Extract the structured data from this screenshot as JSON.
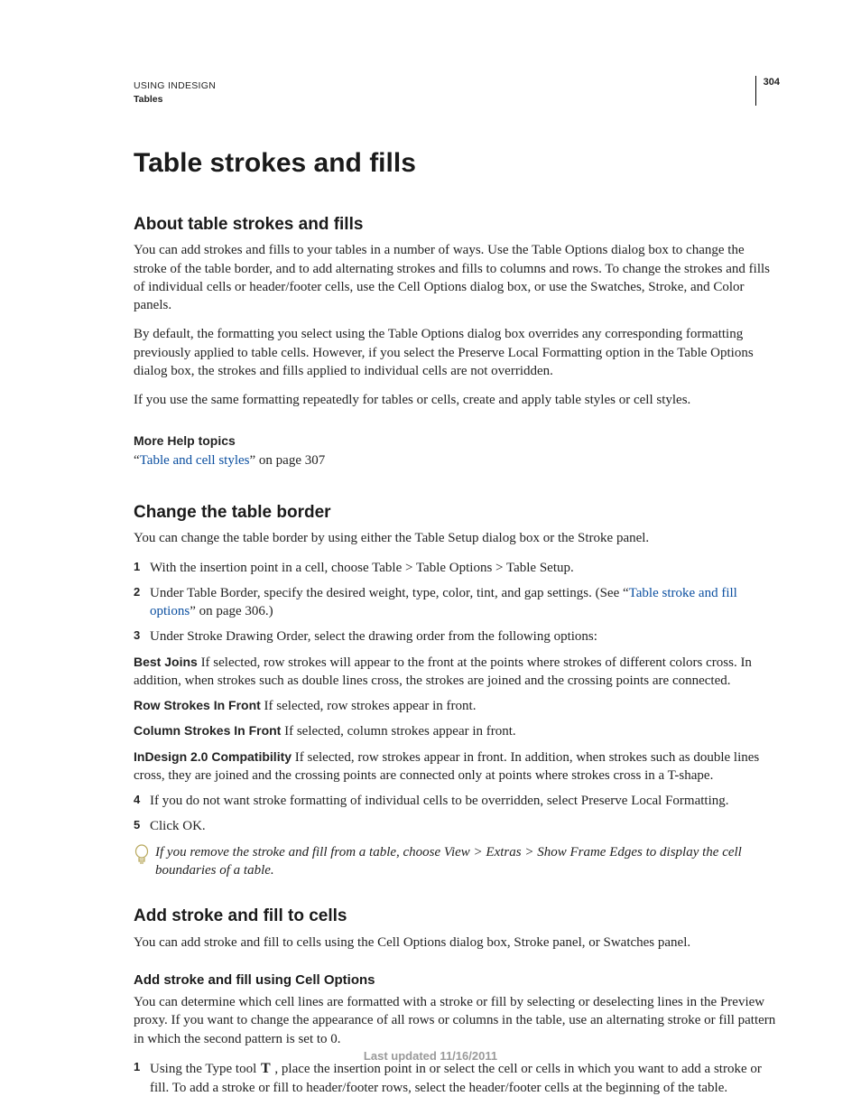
{
  "header": {
    "running_title": "USING INDESIGN",
    "section": "Tables",
    "page_number": "304"
  },
  "main_heading": "Table strokes and fills",
  "section1": {
    "heading": "About table strokes and fills",
    "p1": "You can add strokes and fills to your tables in a number of ways. Use the Table Options dialog box to change the stroke of the table border, and to add alternating strokes and fills to columns and rows. To change the strokes and fills of individual cells or header/footer cells, use the Cell Options dialog box, or use the Swatches, Stroke, and Color panels.",
    "p2": "By default, the formatting you select using the Table Options dialog box overrides any corresponding formatting previously applied to table cells. However, if you select the Preserve Local Formatting option in the Table Options dialog box, the strokes and fills applied to individual cells are not overridden.",
    "p3": "If you use the same formatting repeatedly for tables or cells, create and apply table styles or cell styles."
  },
  "more_help": {
    "heading": "More Help topics",
    "quote_open": "“",
    "link_text": "Table and cell styles",
    "rest": "” on page 307"
  },
  "section2": {
    "heading": "Change the table border",
    "intro": "You can change the table border by using either the Table Setup dialog box or the Stroke panel.",
    "step1": "With the insertion point in a cell, choose Table > Table Options > Table Setup.",
    "step2_a": "Under Table Border, specify the desired weight, type, color, tint, and gap settings. (See “",
    "step2_link": "Table stroke and fill options",
    "step2_b": "” on page 306.)",
    "step3": "Under Stroke Drawing Order, select the drawing order from the following options:",
    "defs": {
      "best_joins_term": "Best Joins",
      "best_joins_text": "  If selected, row strokes will appear to the front at the points where strokes of different colors cross. In addition, when strokes such as double lines cross, the strokes are joined and the crossing points are connected.",
      "row_front_term": "Row Strokes In Front",
      "row_front_text": "  If selected, row strokes appear in front.",
      "col_front_term": "Column Strokes In Front",
      "col_front_text": "  If selected, column strokes appear in front.",
      "compat_term": "InDesign 2.0 Compatibility",
      "compat_text": "  If selected, row strokes appear in front. In addition, when strokes such as double lines cross, they are joined and the crossing points are connected only at points where strokes cross in a T-shape."
    },
    "step4": "If you do not want stroke formatting of individual cells to be overridden, select Preserve Local Formatting.",
    "step5": "Click OK.",
    "tip": "If you remove the stroke and fill from a table, choose View > Extras > Show Frame Edges to display the cell boundaries of a table."
  },
  "section3": {
    "heading": "Add stroke and fill to cells",
    "intro": "You can add stroke and fill to cells using the Cell Options dialog box, Stroke panel, or Swatches panel.",
    "sub_heading": "Add stroke and fill using Cell Options",
    "sub_p": "You can determine which cell lines are formatted with a stroke or fill by selecting or deselecting lines in the Preview proxy. If you want to change the appearance of all rows or columns in the table, use an alternating stroke or fill pattern in which the second pattern is set to 0.",
    "step1_a": "Using the Type tool ",
    "step1_icon": "T",
    "step1_b": " , place the insertion point in or select the cell or cells in which you want to add a stroke or fill. To add a stroke or fill to header/footer rows, select the header/footer cells at the beginning of the table."
  },
  "footer": "Last updated 11/16/2011"
}
